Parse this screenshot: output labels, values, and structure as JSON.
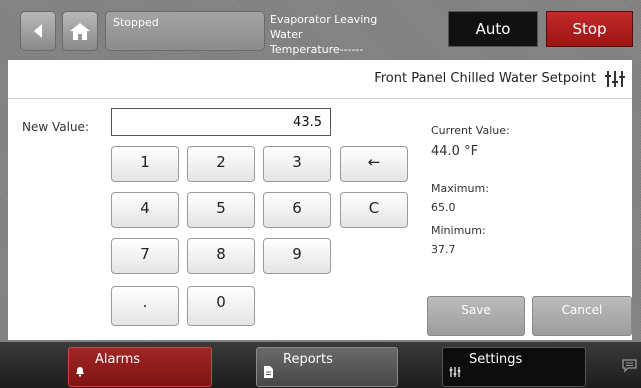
{
  "header": {
    "status_label": "Stopped",
    "status_message_line1": "Evaporator Leaving Water",
    "status_message_line2": "Temperature------",
    "auto_label": "Auto",
    "stop_label": "Stop"
  },
  "panel": {
    "title": "Front Panel Chilled Water Setpoint",
    "new_value_label": "New Value:",
    "new_value": "43.5",
    "keypad": {
      "k1": "1",
      "k2": "2",
      "k3": "3",
      "backspace": "←",
      "k4": "4",
      "k5": "5",
      "k6": "6",
      "clear": "C",
      "k7": "7",
      "k8": "8",
      "k9": "9",
      "dot": ".",
      "k0": "0"
    },
    "current_value_label": "Current Value:",
    "current_value": "44.0 °F",
    "maximum_label": "Maximum:",
    "maximum": "65.0",
    "minimum_label": "Minimum:",
    "minimum": "37.7",
    "save_label": "Save",
    "cancel_label": "Cancel"
  },
  "bottom_nav": {
    "alarms_label": "Alarms",
    "reports_label": "Reports",
    "settings_label": "Settings"
  },
  "colors": {
    "stop": "#b21f1f",
    "alarms": "#8f1c1c",
    "settings": "#0d0d0d"
  },
  "icons": [
    "back-arrow-icon",
    "home-icon",
    "settings-sliders-icon",
    "bell-icon",
    "document-icon",
    "chat-icon"
  ]
}
